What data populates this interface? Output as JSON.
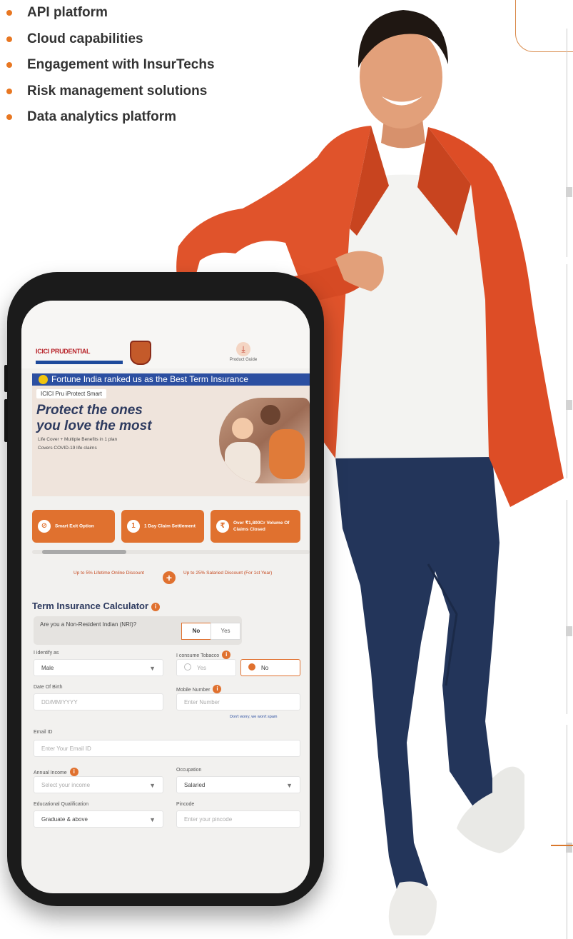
{
  "bullets": [
    "API platform",
    "Cloud capabilities",
    "Engagement with InsurTechs",
    "Risk management solutions",
    "Data analytics platform"
  ],
  "colors": {
    "accent": "#e87722",
    "brand_blue": "#2c4fa1",
    "blazer": "#e0532b"
  },
  "phone": {
    "logo_text": "ICICI PRUDENTIAL",
    "product_guide_label": "Product Guide",
    "banner_text": "Fortune India ranked us as the Best Term Insurance",
    "hero": {
      "product_tag": "ICICI Pru iProtect Smart",
      "title": "Protect the ones\nyou love the most",
      "points": [
        "Life Cover + Multiple Benefits in 1 plan",
        "Covers COVID-19 life claims"
      ]
    },
    "features": [
      {
        "icon": "smart-exit-icon",
        "label": "Smart Exit Option"
      },
      {
        "icon": "claim-icon",
        "label": "1 Day Claim Settlement"
      },
      {
        "icon": "claims-volume-icon",
        "label": "Over ₹1,800Cr Volume Of Claims Closed"
      }
    ],
    "discounts": {
      "left": "Up to 5% Lifetime Online Discount",
      "right": "Up to 25% Salaried Discount (For 1st Year)"
    },
    "calculator": {
      "title": "Term Insurance Calculator",
      "nri_question": "Are you a Non-Resident Indian (NRI)?",
      "nri_options": [
        "No",
        "Yes"
      ],
      "identify_label": "I identify as",
      "identify_value": "Male",
      "tobacco_label": "I consume Tobacco",
      "tobacco_options": [
        "Yes",
        "No"
      ],
      "dob_label": "Date Of Birth",
      "dob_placeholder": "DD/MM/YYYY",
      "mobile_label": "Mobile Number",
      "mobile_placeholder": "Enter Number",
      "mobile_note": "Don't worry, we won't spam",
      "email_label": "Email ID",
      "email_placeholder": "Enter Your Email ID",
      "income_label": "Annual Income",
      "income_placeholder": "Select your income",
      "occupation_label": "Occupation",
      "occupation_value": "Salaried",
      "education_label": "Educational Qualification",
      "education_value": "Graduate & above",
      "pincode_label": "Pincode",
      "pincode_placeholder": "Enter your pincode"
    }
  }
}
